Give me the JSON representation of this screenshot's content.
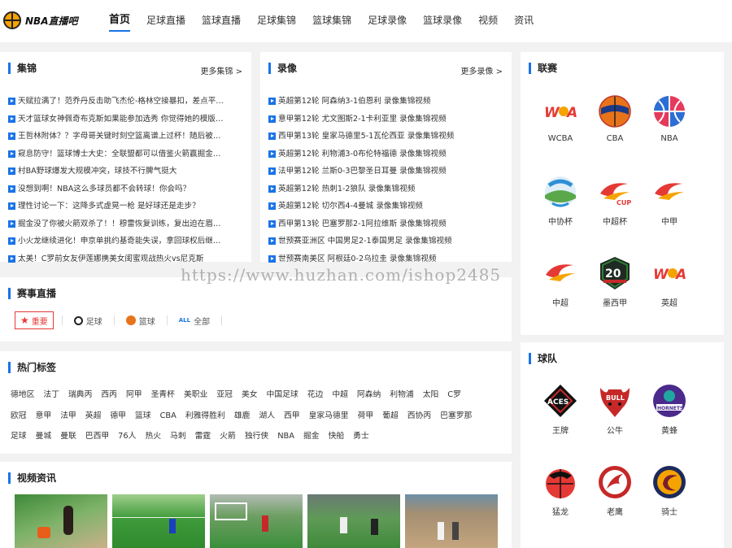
{
  "header": {
    "logo_text": "NBA直播吧",
    "nav": [
      "首页",
      "足球直播",
      "篮球直播",
      "足球集锦",
      "篮球集锦",
      "足球录像",
      "篮球录像",
      "视频",
      "资讯"
    ]
  },
  "jijin": {
    "title": "集锦",
    "more": "更多集锦 >",
    "items": [
      "天赋拉满了！范乔丹反击助飞杰伦-格林空接暴扣，差点平…",
      "天才篮球女神佩奇布克斯如果能参加选秀 你觉得她的模版…",
      "王哲林附体？？字母哥关键时刻空篮离谱上过杯！随后被…",
      "窥息防守！篮球博士大史：全联盟都可以借鉴火箭赢掘金…",
      "村BA野球爆发大规模冲突，球技不行脾气挺大",
      "没想到啊！NBA这么多球员都不会转球！你会吗？",
      "理性讨论一下：这降多式虚晃一枪 是好球还是走步？",
      "掘金没了你被火箭双杀了！！穆雷恢复训练，复出迫在眉…",
      "小火龙继续进化！申京单挑约基奇能失误，拿回球权后继…",
      "太美！C罗前女友伊莲娜携美女闺蜜观战热火vs尼克斯"
    ]
  },
  "luxiang": {
    "title": "录像",
    "more": "更多录像 >",
    "items": [
      "英超第12轮 阿森纳3-1伯恩利 录像集锦视频",
      "意甲第12轮 尤文图斯2-1卡利亚里 录像集锦视频",
      "西甲第13轮 皇家马德里5-1瓦伦西亚 录像集锦视频",
      "英超第12轮 利物浦3-0布伦特福德 录像集锦视频",
      "法甲第12轮 兰斯0-3巴黎圣日耳曼 录像集锦视频",
      "英超第12轮 热刺1-2狼队 录像集锦视频",
      "英超第12轮 切尔西4-4曼城 录像集锦视频",
      "西甲第13轮 巴塞罗那2-1阿拉维斯 录像集锦视频",
      "世预赛亚洲区 中国男足2-1泰国男足 录像集锦视频",
      "世预赛南美区 阿根廷0-2乌拉圭 录像集锦视频"
    ]
  },
  "liansai": {
    "title": "联赛",
    "items": [
      {
        "name": "WCBA",
        "icon": "wcba-logo"
      },
      {
        "name": "CBA",
        "icon": "cba-logo"
      },
      {
        "name": "NBA",
        "icon": "nba-logo"
      },
      {
        "name": "中协杯",
        "icon": "cfa-cup-logo"
      },
      {
        "name": "中超杯",
        "icon": "super-cup-logo"
      },
      {
        "name": "中甲",
        "icon": "china-league-one-logo"
      },
      {
        "name": "中超",
        "icon": "csl-logo"
      },
      {
        "name": "墨西甲",
        "icon": "liga-mx-logo"
      },
      {
        "name": "英超",
        "icon": "premier-league-logo"
      }
    ]
  },
  "saishi": {
    "title": "赛事直播",
    "tabs": [
      {
        "label": "重要",
        "icon": "star-icon"
      },
      {
        "label": "足球",
        "icon": "football-icon"
      },
      {
        "label": "篮球",
        "icon": "basketball-icon"
      },
      {
        "label": "全部",
        "icon": "all-icon",
        "icon_text": "ALL"
      }
    ]
  },
  "tags": {
    "title": "热门标签",
    "rows": [
      [
        "德地区",
        "法丁",
        "瑞典丙",
        "西丙",
        "阿甲",
        "圣青杯",
        "美职业",
        "亚冠",
        "美女",
        "中国足球",
        "花边",
        "中超",
        "阿森纳",
        "利物浦",
        "太阳",
        "C罗"
      ],
      [
        "欧冠",
        "意甲",
        "法甲",
        "英超",
        "德甲",
        "篮球",
        "CBA",
        "利雅得胜利",
        "雄鹿",
        "湖人",
        "西甲",
        "皇家马德里",
        "荷甲",
        "葡超",
        "西协丙",
        "巴塞罗那"
      ],
      [
        "足球",
        "曼城",
        "曼联",
        "巴西甲",
        "76人",
        "热火",
        "马刺",
        "雷霆",
        "火箭",
        "独行侠",
        "NBA",
        "掘金",
        "快船",
        "勇士"
      ]
    ]
  },
  "video": {
    "title": "视频资讯"
  },
  "team": {
    "title": "球队",
    "items": [
      {
        "name": "王牌",
        "icon": "aces-logo"
      },
      {
        "name": "公牛",
        "icon": "bulls-logo"
      },
      {
        "name": "黄蜂",
        "icon": "hornets-logo"
      },
      {
        "name": "猛龙",
        "icon": "raptors-logo"
      },
      {
        "name": "老鹰",
        "icon": "hawks-logo"
      },
      {
        "name": "骑士",
        "icon": "cavaliers-logo"
      }
    ]
  },
  "watermark": "https://www.huzhan.com/ishop2485",
  "colors": {
    "accent": "#1a73e8",
    "important": "#e53935"
  }
}
